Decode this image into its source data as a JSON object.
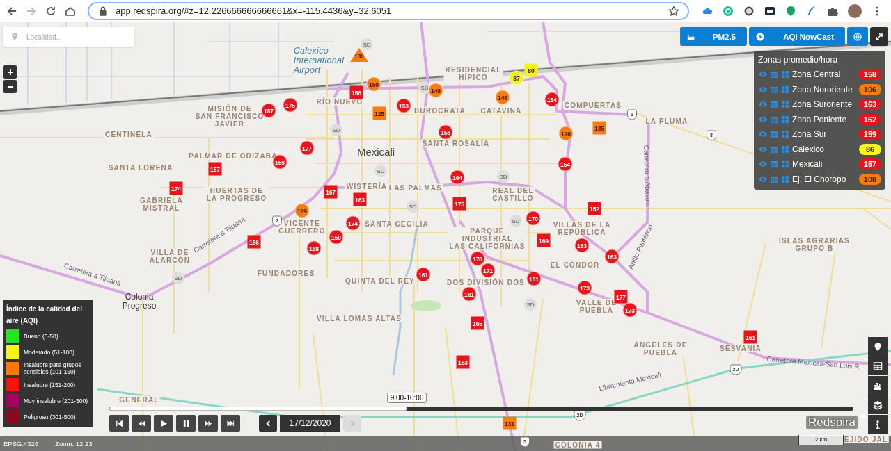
{
  "browser": {
    "url": "app.redspira.org/#z=12.226666666666661&x=-115.4436&y=32.6051",
    "nav": [
      {
        "kind": "back",
        "disabled": false
      },
      {
        "kind": "forward",
        "disabled": true
      },
      {
        "kind": "reload",
        "disabled": false
      },
      {
        "kind": "home",
        "disabled": false
      }
    ]
  },
  "search": {
    "placeholder": "Localidad..."
  },
  "top_buttons": [
    {
      "kind": "pollutant",
      "label": "PM2.5"
    },
    {
      "kind": "index",
      "label": "AQI NowCast"
    },
    {
      "kind": "globe"
    },
    {
      "kind": "fullscreen"
    }
  ],
  "zones": {
    "title": "Zonas promedio/hora",
    "items": [
      {
        "name": "Zona Central",
        "value": "158",
        "color": "#e8141b"
      },
      {
        "name": "Zona Nororiente",
        "value": "106",
        "color": "#f57c12"
      },
      {
        "name": "Zona Suroriente",
        "value": "163",
        "color": "#e8141b"
      },
      {
        "name": "Zona Poniente",
        "value": "162",
        "color": "#e8141b"
      },
      {
        "name": "Zona Sur",
        "value": "159",
        "color": "#e8141b"
      },
      {
        "name": "Calexico",
        "value": "86",
        "color": "#f7f71e"
      },
      {
        "name": "Mexicali",
        "value": "157",
        "color": "#e8141b"
      },
      {
        "name": "Ej. El Choropo",
        "value": "108",
        "color": "#f57c12"
      }
    ]
  },
  "legend": {
    "title": "Índice de la calidad del aire (AQI)",
    "items": [
      {
        "label": "Bueno (0-50)",
        "color": "#22e622"
      },
      {
        "label": "Moderado (51-100)",
        "color": "#f5f514"
      },
      {
        "label": "Insalubre para grupos sensibles (101-150)",
        "color": "#fc7a0a"
      },
      {
        "label": "Insalubre (151-200)",
        "color": "#fa1010"
      },
      {
        "label": "Muy insalubre (201-300)",
        "color": "#a3055c"
      },
      {
        "label": "Peligroso (301-500)",
        "color": "#8c0a1e"
      }
    ]
  },
  "map": {
    "labels": [
      {
        "kind": "district",
        "text": "RESIDENCIAL\nHÍPICO"
      },
      {
        "kind": "district",
        "text": "MISIÓN DE\nSAN FRANCISCO\nJAVIER"
      },
      {
        "kind": "district",
        "text": "RÍO NUEVO"
      },
      {
        "kind": "district",
        "text": "BUROCRATA"
      },
      {
        "kind": "district",
        "text": "CATAVINA"
      },
      {
        "kind": "district",
        "text": "COMPUERTAS"
      },
      {
        "kind": "district",
        "text": "CENTINELA"
      },
      {
        "kind": "district",
        "text": "SANTA ROSALÍA"
      },
      {
        "kind": "district",
        "text": "LA PLUMA"
      },
      {
        "kind": "district",
        "text": "PALMAR DE ORIZABA"
      },
      {
        "kind": "district",
        "text": "SANTA LORENA"
      },
      {
        "kind": "district",
        "text": "HUERTAS DE\nLA PROGRESO"
      },
      {
        "kind": "district",
        "text": "GABRIELA\nMISTRAL"
      },
      {
        "kind": "district",
        "text": "WISTERÍA"
      },
      {
        "kind": "district",
        "text": "LAS PALMAS"
      },
      {
        "kind": "district",
        "text": "REAL DEL\nCASTILLO"
      },
      {
        "kind": "district",
        "text": "VICENTE\nGUERRERO"
      },
      {
        "kind": "district",
        "text": "SANTA CECILIA"
      },
      {
        "kind": "district",
        "text": "PARQUE\nINDUSTRIAL\nLAS CALIFORNIAS"
      },
      {
        "kind": "district",
        "text": "VILLAS DE LA\nREPÚBLICA"
      },
      {
        "kind": "district",
        "text": "ISLAS AGRARIAS\nGRUPO B"
      },
      {
        "kind": "district",
        "text": "VILLA DE\nALARCÓN"
      },
      {
        "kind": "district",
        "text": "EL CÓNDOR"
      },
      {
        "kind": "district",
        "text": "FUNDADORES"
      },
      {
        "kind": "district",
        "text": "QUINTA DEL REY"
      },
      {
        "kind": "district",
        "text": "DOS DIVISIÓN DOS"
      },
      {
        "kind": "district",
        "text": "VALLE DE\nPUEBLA"
      },
      {
        "kind": "district",
        "text": "VILLA LOMAS ALTAS"
      },
      {
        "kind": "district",
        "text": "ÁNGELES DE\nPUEBLA"
      },
      {
        "kind": "district",
        "text": "SESVANIA"
      },
      {
        "kind": "district",
        "text": "GENERAL"
      },
      {
        "kind": "district",
        "text": "COLONIA 4"
      },
      {
        "kind": "district",
        "text": "EJIDO JAL"
      },
      {
        "kind": "city",
        "text": "Mexicali"
      },
      {
        "kind": "town",
        "text": "Colonia\nProgreso"
      },
      {
        "kind": "airport",
        "text": "Calexico\nInternational\nAirport"
      },
      {
        "kind": "road",
        "text": "Carretera a Tijuana"
      },
      {
        "kind": "road",
        "text": "Carretera a Tijuana"
      },
      {
        "kind": "road",
        "text": "Carretera a Abasolo"
      },
      {
        "kind": "road",
        "text": "Anillo Periférico"
      },
      {
        "kind": "road",
        "text": "Carretera Mexicali-San Luis R"
      },
      {
        "kind": "road",
        "text": "Libramiento Mexicali"
      },
      {
        "kind": "shield",
        "text": "1"
      },
      {
        "kind": "shield",
        "text": "8"
      },
      {
        "kind": "shield",
        "text": "2"
      },
      {
        "kind": "shield",
        "text": "2D"
      },
      {
        "kind": "shield",
        "text": "2D"
      },
      {
        "kind": "shield",
        "text": "5"
      },
      {
        "kind": "sd",
        "text": "SD"
      },
      {
        "kind": "sd",
        "text": "SD"
      },
      {
        "kind": "sd",
        "text": "SD"
      },
      {
        "kind": "sd",
        "text": "SD"
      },
      {
        "kind": "sd",
        "text": "SD"
      },
      {
        "kind": "sd",
        "text": "SD"
      },
      {
        "kind": "sd",
        "text": "SD"
      },
      {
        "kind": "sd",
        "text": "SD"
      },
      {
        "kind": "sd",
        "text": "SD"
      }
    ],
    "markers": [
      {
        "value": "132",
        "kind": "triangle",
        "color": "#f57c12"
      },
      {
        "value": "150",
        "kind": "circle",
        "color": "#f57c12"
      },
      {
        "value": "156",
        "kind": "square",
        "color": "#e8141b"
      },
      {
        "value": "148",
        "kind": "circle",
        "color": "#f57c12"
      },
      {
        "value": "153",
        "kind": "circle",
        "color": "#e8141b"
      },
      {
        "value": "187",
        "kind": "circle",
        "color": "#e8141b"
      },
      {
        "value": "175",
        "kind": "circle",
        "color": "#e8141b"
      },
      {
        "value": "125",
        "kind": "square",
        "color": "#f57c12"
      },
      {
        "value": "87",
        "kind": "circle",
        "color": "#f2f21e"
      },
      {
        "value": "80",
        "kind": "square",
        "color": "#f2f21e"
      },
      {
        "value": "146",
        "kind": "circle",
        "color": "#f57c12"
      },
      {
        "value": "154",
        "kind": "circle",
        "color": "#e8141b"
      },
      {
        "value": "135",
        "kind": "square",
        "color": "#f57c12"
      },
      {
        "value": "126",
        "kind": "circle",
        "color": "#f57c12"
      },
      {
        "value": "153",
        "kind": "circle",
        "color": "#e8141b"
      },
      {
        "value": "177",
        "kind": "circle",
        "color": "#e8141b"
      },
      {
        "value": "159",
        "kind": "circle",
        "color": "#e8141b"
      },
      {
        "value": "157",
        "kind": "square",
        "color": "#e8141b"
      },
      {
        "value": "154",
        "kind": "circle",
        "color": "#e8141b"
      },
      {
        "value": "164",
        "kind": "circle",
        "color": "#e8141b"
      },
      {
        "value": "174",
        "kind": "square",
        "color": "#e8141b"
      },
      {
        "value": "167",
        "kind": "square",
        "color": "#e8141b"
      },
      {
        "value": "163",
        "kind": "square",
        "color": "#e8141b"
      },
      {
        "value": "175",
        "kind": "square",
        "color": "#e8141b"
      },
      {
        "value": "129",
        "kind": "circle",
        "color": "#f57c12"
      },
      {
        "value": "152",
        "kind": "square",
        "color": "#e8141b"
      },
      {
        "value": "170",
        "kind": "circle",
        "color": "#e8141b"
      },
      {
        "value": "174",
        "kind": "circle",
        "color": "#e8141b"
      },
      {
        "value": "159",
        "kind": "circle",
        "color": "#e8141b"
      },
      {
        "value": "156",
        "kind": "square",
        "color": "#e8141b"
      },
      {
        "value": "169",
        "kind": "square",
        "color": "#e8141b"
      },
      {
        "value": "163",
        "kind": "circle",
        "color": "#e8141b"
      },
      {
        "value": "168",
        "kind": "circle",
        "color": "#e8141b"
      },
      {
        "value": "178",
        "kind": "circle",
        "color": "#e8141b"
      },
      {
        "value": "171",
        "kind": "circle",
        "color": "#e8141b"
      },
      {
        "value": "163",
        "kind": "circle",
        "color": "#e8141b"
      },
      {
        "value": "161",
        "kind": "circle",
        "color": "#e8141b"
      },
      {
        "value": "181",
        "kind": "circle",
        "color": "#e8141b"
      },
      {
        "value": "173",
        "kind": "circle",
        "color": "#e8141b"
      },
      {
        "value": "161",
        "kind": "circle",
        "color": "#e8141b"
      },
      {
        "value": "177",
        "kind": "square",
        "color": "#e8141b"
      },
      {
        "value": "173",
        "kind": "circle",
        "color": "#e8141b"
      },
      {
        "value": "165",
        "kind": "square",
        "color": "#e8141b"
      },
      {
        "value": "161",
        "kind": "square",
        "color": "#e8141b"
      },
      {
        "value": "153",
        "kind": "square",
        "color": "#e8141b"
      },
      {
        "value": "131",
        "kind": "square",
        "color": "#f57c12"
      }
    ]
  },
  "timeline": {
    "time": "9:00-10:00",
    "level": 0.4,
    "date": "17/12/2020",
    "date_buttons": [
      {
        "kind": "prev",
        "disabled": false
      },
      {
        "kind": "next",
        "disabled": true
      }
    ]
  },
  "brand": "Redspira",
  "scale": "2 km",
  "status_bar": {
    "projection": "EPSG:4326",
    "zoom": "Zoom: 12.23"
  }
}
